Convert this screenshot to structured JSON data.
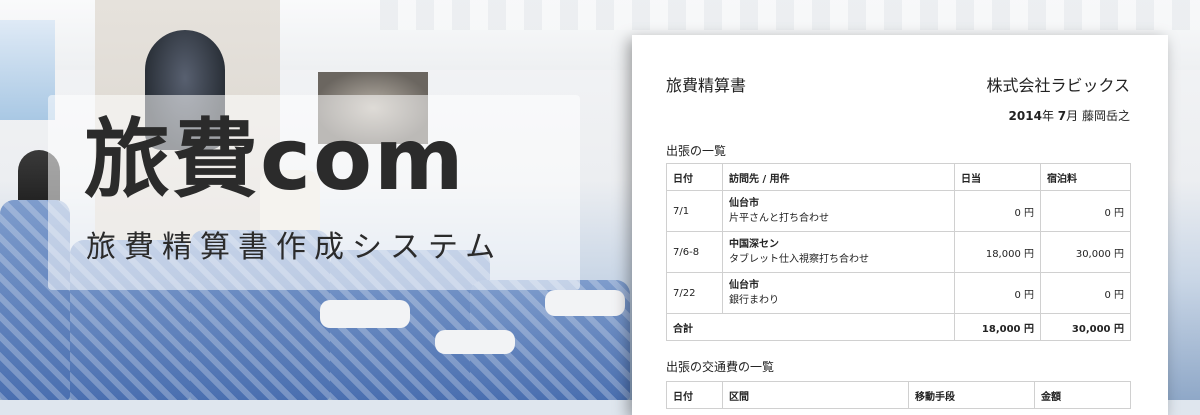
{
  "banner": {
    "title": "旅費com",
    "subtitle": "旅費精算書作成システム"
  },
  "document": {
    "title": "旅費精算書",
    "company": "株式会社ラビックス",
    "year": "2014",
    "year_suffix": "年",
    "month": "7",
    "month_suffix": "月",
    "person": "藤岡岳之",
    "trips_section_title": "出張の一覧",
    "trips_table": {
      "headers": [
        "日付",
        "訪問先 / 用件",
        "日当",
        "宿泊料"
      ],
      "rows": [
        {
          "date": "7/1",
          "destination": "仙台市",
          "purpose": "片平さんと打ち合わせ",
          "daily": "0 円",
          "lodging": "0 円"
        },
        {
          "date": "7/6-8",
          "destination": "中国深セン",
          "purpose": "タブレット仕入視察打ち合わせ",
          "daily": "18,000 円",
          "lodging": "30,000 円"
        },
        {
          "date": "7/22",
          "destination": "仙台市",
          "purpose": "銀行まわり",
          "daily": "0 円",
          "lodging": "0 円"
        }
      ],
      "total": {
        "label": "合計",
        "daily": "18,000 円",
        "lodging": "30,000 円"
      }
    },
    "transport_section_title": "出張の交通費の一覧",
    "transport_table": {
      "headers": [
        "日付",
        "区間",
        "移動手段",
        "金額"
      ]
    }
  }
}
